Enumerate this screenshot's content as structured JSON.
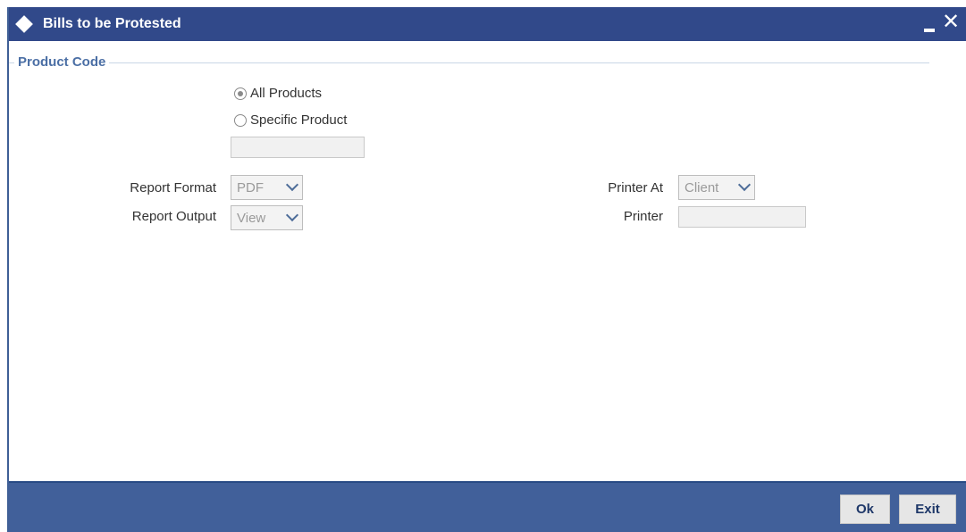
{
  "window": {
    "title": "Bills to be Protested",
    "minimize_icon": "minimize-icon",
    "close_label": "✕"
  },
  "section": {
    "title": "Product Code"
  },
  "product_options": [
    {
      "label": "All Products",
      "checked": true
    },
    {
      "label": "Specific Product",
      "checked": false
    }
  ],
  "specific_product_input": {
    "value": ""
  },
  "report": {
    "format_label": "Report Format",
    "format_value": "PDF",
    "output_label": "Report Output",
    "output_value": "View"
  },
  "printer": {
    "printer_at_label": "Printer At",
    "printer_at_value": "Client",
    "printer_label": "Printer",
    "printer_value": ""
  },
  "footer": {
    "ok_label": "Ok",
    "exit_label": "Exit"
  },
  "colors": {
    "title_bar": "#31498a",
    "footer": "#41609a",
    "section_title": "#4b6fa5"
  }
}
